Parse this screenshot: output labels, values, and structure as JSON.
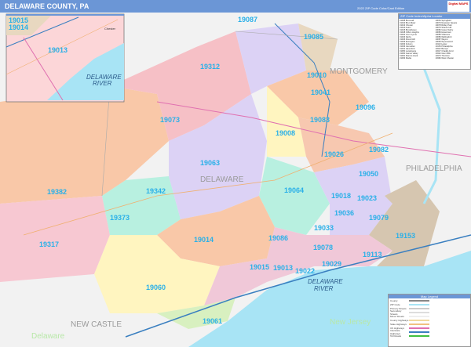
{
  "header": {
    "title": "DELAWARE COUNTY, PA",
    "edition": "2022 ZIP Code Color/Cast Edition",
    "logo": "Digital MAPS"
  },
  "colors": {
    "header": "#6b96d6",
    "water": "#a8e4f5",
    "zip_label": "#2ab0e8"
  },
  "zip_labels": [
    {
      "zip": "19087"
    },
    {
      "zip": "19085"
    },
    {
      "zip": "19010"
    },
    {
      "zip": "19041"
    },
    {
      "zip": "19096"
    },
    {
      "zip": "19083"
    },
    {
      "zip": "19008"
    },
    {
      "zip": "19026"
    },
    {
      "zip": "19082"
    },
    {
      "zip": "19050"
    },
    {
      "zip": "19064"
    },
    {
      "zip": "19018"
    },
    {
      "zip": "19023"
    },
    {
      "zip": "19312"
    },
    {
      "zip": "19073"
    },
    {
      "zip": "19063"
    },
    {
      "zip": "19342"
    },
    {
      "zip": "19382"
    },
    {
      "zip": "19373"
    },
    {
      "zip": "19014"
    },
    {
      "zip": "19086"
    },
    {
      "zip": "19015"
    },
    {
      "zip": "19013"
    },
    {
      "zip": "19022"
    },
    {
      "zip": "19078"
    },
    {
      "zip": "19029"
    },
    {
      "zip": "19113"
    },
    {
      "zip": "19153"
    },
    {
      "zip": "19317"
    },
    {
      "zip": "19060"
    },
    {
      "zip": "19061"
    },
    {
      "zip": "19033"
    },
    {
      "zip": "19079"
    },
    {
      "zip": "19036"
    }
  ],
  "place_labels": {
    "county": "DELAWARE",
    "philadelphia": "PHILADELPHIA",
    "montgomery": "MONTGOMERY",
    "new_castle": "NEW CASTLE",
    "new_jersey": "New Jersey",
    "delaware_state": "Delaware",
    "river_1": "DELAWARE",
    "river_2": "RIVER"
  },
  "inset": {
    "zips": [
      "19015",
      "19014",
      "19013"
    ],
    "river_1": "DELAWARE",
    "river_2": "RIVER",
    "town": "Chester"
  },
  "index": {
    "title": "ZIP Code Index/Alpha Locator",
    "rows": [
      "19008 Broomall",
      "19010 Bryn Mawr",
      "19013 Chester",
      "19014 Aston",
      "19015 Brookhaven",
      "19018 Clifton Heights",
      "19022 Crum Lynne",
      "19023 Darby",
      "19026 Drexel Hill",
      "19029 Essington",
      "19033 Folsom",
      "19036 Glenolden",
      "19041 Haverford",
      "19050 Lansdowne",
      "19060 Garnet Valley",
      "19061 Marcus Hook",
      "19063 Media",
      "19064 Springfield",
      "19073 Newtown Square",
      "19078 Ridley Park",
      "19079 Sharon Hill",
      "19082 Upper Darby",
      "19083 Havertown",
      "19085 Villanova",
      "19086 Wallingford",
      "19087 Wayne",
      "19096 Wynnewood",
      "19113 Lester",
      "19153 Philadelphia",
      "19312 Berwyn",
      "19317 Chadds Ford",
      "19342 Glen Mills",
      "19373 Thornton",
      "19382 West Chester"
    ]
  },
  "legend": {
    "title": "Map Legend",
    "items": [
      "County",
      "ZIP Code",
      "Primary Streets",
      "Secondary Streets",
      "Minor Streets",
      "County Highways",
      "State Highways",
      "US Highways",
      "Interstate Highways",
      "Toll Roads"
    ]
  }
}
